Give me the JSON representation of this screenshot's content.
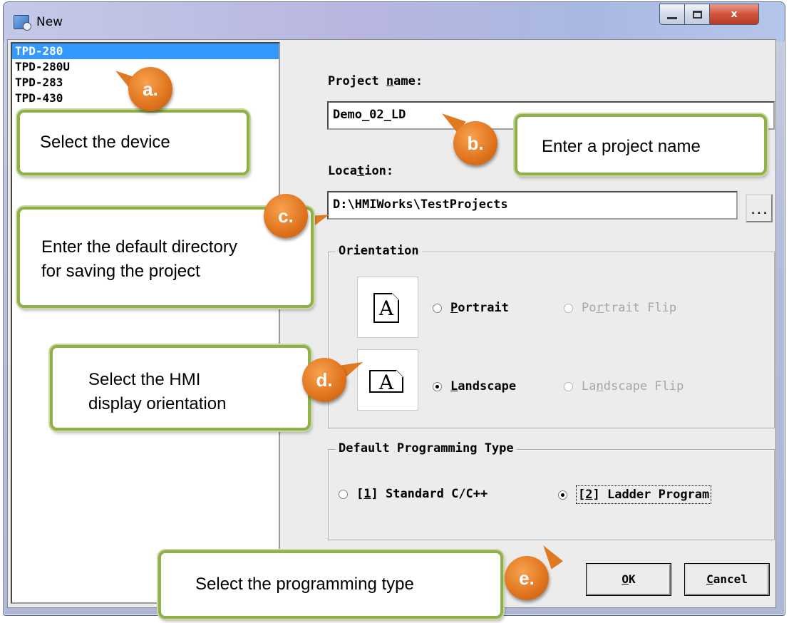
{
  "window": {
    "title": "New",
    "close_glyph": "x"
  },
  "device_list": {
    "items": [
      "TPD-280",
      "TPD-280U",
      "TPD-283",
      "TPD-430"
    ],
    "selected_index": 0
  },
  "project_name": {
    "label_pre": "Project ",
    "label_key": "n",
    "label_post": "ame:",
    "value": "Demo_02_LD"
  },
  "location": {
    "label_pre": "Loca",
    "label_key": "t",
    "label_post": "ion:",
    "value": "D:\\HMIWorks\\TestProjects",
    "browse_label": "..."
  },
  "orientation": {
    "title": "Orientation",
    "icon_glyph": "A",
    "portrait": {
      "key": "P",
      "rest": "ortrait",
      "checked": false
    },
    "portrait_flip": {
      "pre": "Po",
      "key": "r",
      "rest": "trait Flip",
      "disabled": true
    },
    "landscape": {
      "key": "L",
      "rest": "andscape",
      "checked": true
    },
    "landscape_flip": {
      "pre": "La",
      "key": "n",
      "rest": "dscape Flip",
      "disabled": true
    }
  },
  "programming_type": {
    "title": "Default Programming Type",
    "options": [
      {
        "pre": "[",
        "key": "1",
        "rest": "] Standard C/C++",
        "checked": false
      },
      {
        "pre": "[",
        "key": "2",
        "rest": "] Ladder Program",
        "checked": true
      }
    ]
  },
  "buttons": {
    "ok": {
      "key": "O",
      "rest": "K"
    },
    "cancel": {
      "key": "C",
      "rest": "ancel"
    }
  },
  "annotations": {
    "a": {
      "marker": "a.",
      "text": "Select the device"
    },
    "b": {
      "marker": "b.",
      "text": "Enter a project name"
    },
    "c": {
      "marker": "c.",
      "line1": "Enter the default directory",
      "line2": "for saving the project"
    },
    "d": {
      "marker": "d.",
      "line1": "Select the HMI",
      "line2": "display orientation"
    },
    "e": {
      "marker": "e.",
      "text": "Select the programming type"
    }
  },
  "colors": {
    "selection": "#3399ff",
    "callout_border": "#8fb04a",
    "marker": "#e0731c"
  }
}
